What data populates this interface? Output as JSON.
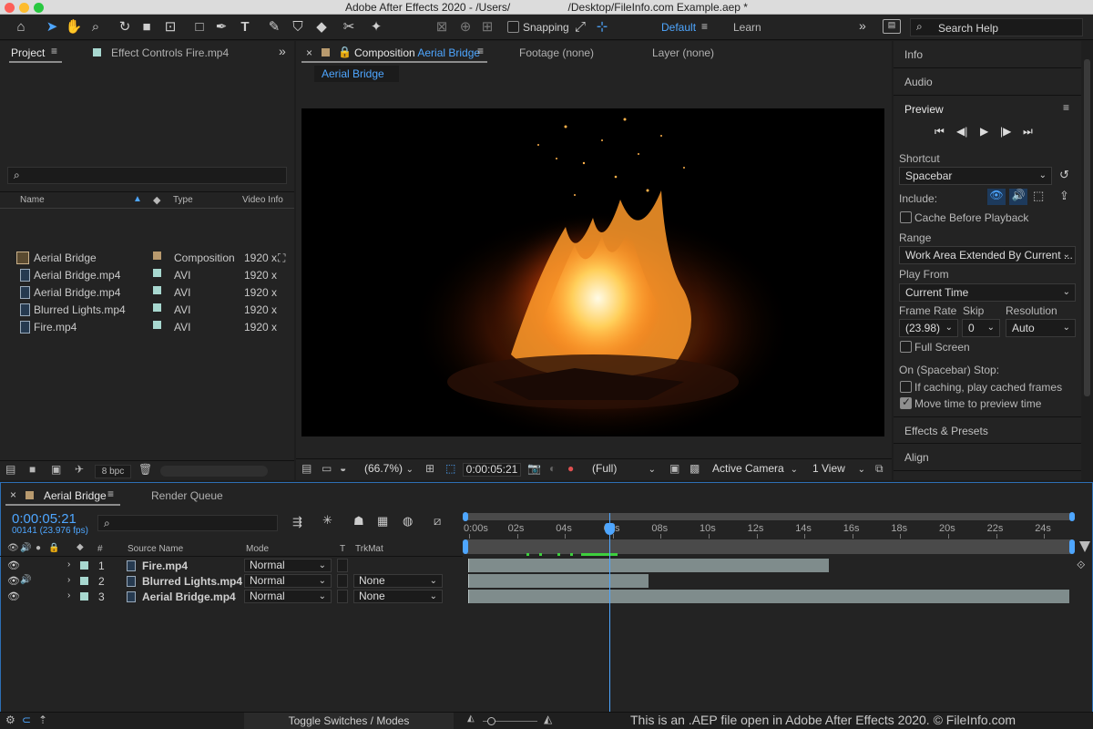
{
  "window": {
    "title": "Adobe After Effects 2020 - /Users/                   /Desktop/FileInfo.com Example.aep *"
  },
  "toolbar": {
    "snapping": "Snapping",
    "workspace_default": "Default",
    "workspace_learn": "Learn",
    "search_help": "Search Help"
  },
  "project": {
    "tab_project": "Project",
    "tab_effect_controls": "Effect Controls Fire.mp4",
    "columns": {
      "name": "Name",
      "type": "Type",
      "video_info": "Video Info"
    },
    "items": [
      {
        "name": "Aerial Bridge",
        "type": "Composition",
        "info": "1920 x",
        "label_color": "#b89a6e",
        "kind": "comp"
      },
      {
        "name": "Aerial Bridge.mp4",
        "type": "AVI",
        "info": "1920 x",
        "label_color": "#a8d8d0",
        "kind": "file"
      },
      {
        "name": "Aerial Bridge.mp4",
        "type": "AVI",
        "info": "1920 x",
        "label_color": "#a8d8d0",
        "kind": "file"
      },
      {
        "name": "Blurred Lights.mp4",
        "type": "AVI",
        "info": "1920 x",
        "label_color": "#a8d8d0",
        "kind": "file"
      },
      {
        "name": "Fire.mp4",
        "type": "AVI",
        "info": "1920 x",
        "label_color": "#a8d8d0",
        "kind": "file"
      }
    ],
    "bpc": "8 bpc"
  },
  "composition": {
    "tab_prefix": "Composition",
    "tab_name": "Aerial Bridge",
    "footage": "Footage (none)",
    "layer": "Layer (none)",
    "breadcrumb": "Aerial Bridge",
    "zoom": "(66.7%)",
    "timecode": "0:00:05:21",
    "resolution": "(Full)",
    "camera": "Active Camera",
    "views": "1 View"
  },
  "right_panel": {
    "info": "Info",
    "audio": "Audio",
    "preview": "Preview",
    "shortcut_label": "Shortcut",
    "shortcut_value": "Spacebar",
    "include_label": "Include:",
    "cache_before_playback": "Cache Before Playback",
    "range_label": "Range",
    "range_value": "Work Area Extended By Current ...",
    "play_from_label": "Play From",
    "play_from_value": "Current Time",
    "frame_rate_label": "Frame Rate",
    "frame_rate_value": "(23.98)",
    "skip_label": "Skip",
    "skip_value": "0",
    "resolution_label": "Resolution",
    "resolution_value": "Auto",
    "full_screen": "Full Screen",
    "stop_label": "On (Spacebar) Stop:",
    "if_caching": "If caching, play cached frames",
    "move_time": "Move time to preview time",
    "effects_presets": "Effects & Presets",
    "align": "Align"
  },
  "timeline": {
    "tab_comp": "Aerial Bridge",
    "tab_render": "Render Queue",
    "timecode": "0:00:05:21",
    "frame_info": "00141 (23.976 fps)",
    "columns": {
      "hash": "#",
      "source": "Source Name",
      "mode": "Mode",
      "t": "T",
      "trkmat": "TrkMat"
    },
    "ruler": [
      "0:00s",
      "02s",
      "04s",
      "06s",
      "08s",
      "10s",
      "12s",
      "14s",
      "16s",
      "18s",
      "20s",
      "22s",
      "24s"
    ],
    "layers": [
      {
        "num": "1",
        "name": "Fire.mp4",
        "mode": "Normal",
        "trkmat": "",
        "bar_end": 0.6
      },
      {
        "num": "2",
        "name": "Blurred Lights.mp4",
        "mode": "Normal",
        "trkmat": "None",
        "bar_end": 0.3
      },
      {
        "num": "3",
        "name": "Aerial Bridge.mp4",
        "mode": "Normal",
        "trkmat": "None",
        "bar_end": 1.0
      }
    ],
    "toggle_label": "Toggle Switches / Modes",
    "watermark": "This is an .AEP file open in Adobe After Effects 2020. © FileInfo.com"
  },
  "colors": {
    "accent": "#3d9bff",
    "panel": "#232323",
    "bg": "#1d1d1d"
  }
}
